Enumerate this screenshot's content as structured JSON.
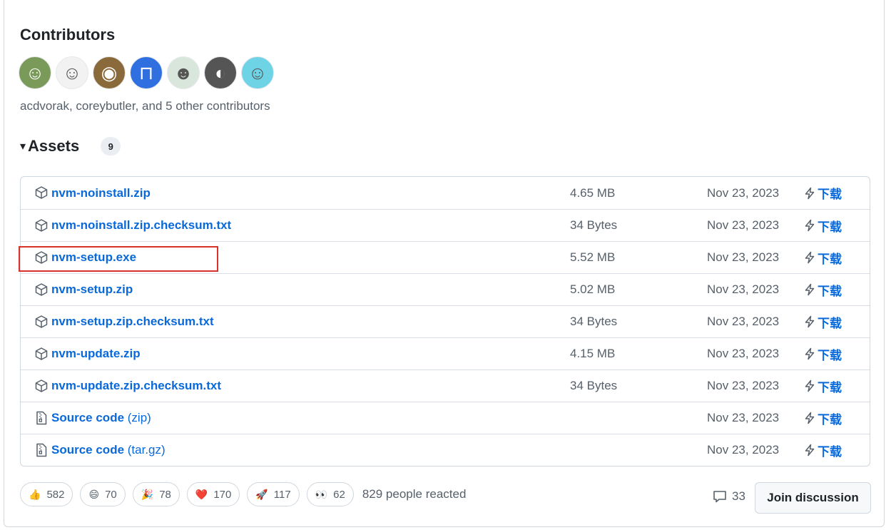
{
  "contributors": {
    "title": "Contributors",
    "avatars": [
      {
        "name": "avatar-1",
        "bg": "#7a9a5a",
        "glyph": "☺"
      },
      {
        "name": "avatar-2",
        "bg": "#f2f2f2",
        "glyph": "☺"
      },
      {
        "name": "avatar-3",
        "bg": "#8a6a3a",
        "glyph": "◉"
      },
      {
        "name": "avatar-4",
        "bg": "#2f6fe0",
        "glyph": "⊓"
      },
      {
        "name": "avatar-5",
        "bg": "#d8e6dc",
        "glyph": "☻"
      },
      {
        "name": "avatar-6",
        "bg": "#555555",
        "glyph": "◐"
      },
      {
        "name": "avatar-7",
        "bg": "#6fd3e6",
        "glyph": "☺"
      }
    ],
    "summary": "acdvorak, coreybutler, and 5 other contributors"
  },
  "assets": {
    "caret": "▾",
    "title": "Assets",
    "count": "9",
    "download_label": "下载",
    "rows": [
      {
        "name": "nvm-noinstall.zip",
        "suffix": "",
        "icon": "package-icon",
        "size": "4.65 MB",
        "date": "Nov 23, 2023"
      },
      {
        "name": "nvm-noinstall.zip.checksum.txt",
        "suffix": "",
        "icon": "package-icon",
        "size": "34 Bytes",
        "date": "Nov 23, 2023"
      },
      {
        "name": "nvm-setup.exe",
        "suffix": "",
        "icon": "package-icon",
        "size": "5.52 MB",
        "date": "Nov 23, 2023"
      },
      {
        "name": "nvm-setup.zip",
        "suffix": "",
        "icon": "package-icon",
        "size": "5.02 MB",
        "date": "Nov 23, 2023"
      },
      {
        "name": "nvm-setup.zip.checksum.txt",
        "suffix": "",
        "icon": "package-icon",
        "size": "34 Bytes",
        "date": "Nov 23, 2023"
      },
      {
        "name": "nvm-update.zip",
        "suffix": "",
        "icon": "package-icon",
        "size": "4.15 MB",
        "date": "Nov 23, 2023"
      },
      {
        "name": "nvm-update.zip.checksum.txt",
        "suffix": "",
        "icon": "package-icon",
        "size": "34 Bytes",
        "date": "Nov 23, 2023"
      },
      {
        "name": "Source code",
        "suffix": " (zip)",
        "icon": "file-zip-icon",
        "size": "",
        "date": "Nov 23, 2023"
      },
      {
        "name": "Source code",
        "suffix": " (tar.gz)",
        "icon": "file-zip-icon",
        "size": "",
        "date": "Nov 23, 2023"
      }
    ]
  },
  "reactions": {
    "items": [
      {
        "emoji": "👍",
        "name": "thumbs-up",
        "count": "582"
      },
      {
        "emoji": "😄",
        "name": "laugh",
        "count": "70"
      },
      {
        "emoji": "🎉",
        "name": "hooray",
        "count": "78"
      },
      {
        "emoji": "❤️",
        "name": "heart",
        "count": "170"
      },
      {
        "emoji": "🚀",
        "name": "rocket",
        "count": "117"
      },
      {
        "emoji": "👀",
        "name": "eyes",
        "count": "62"
      }
    ],
    "summary": "829 people reacted"
  },
  "discussion": {
    "comment_count": "33",
    "join_label": "Join discussion"
  },
  "colors": {
    "link": "#0969da",
    "highlight_border": "#d9312b",
    "muted_text": "#57606a"
  }
}
